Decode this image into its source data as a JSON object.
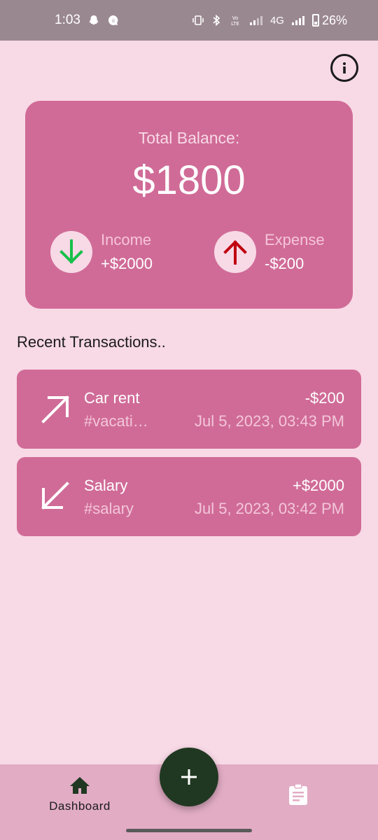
{
  "status_bar": {
    "time": "1:03",
    "battery": "26%",
    "network": "4G",
    "icons": [
      "snapchat-icon",
      "chat-icon",
      "vibrate-icon",
      "bluetooth-icon",
      "volte-icon",
      "signal-icon",
      "battery-icon"
    ]
  },
  "balance": {
    "label": "Total Balance:",
    "amount": "$1800",
    "income_label": "Income",
    "income_value": "+$2000",
    "expense_label": "Expense",
    "expense_value": "-$200"
  },
  "recent": {
    "title": "Recent Transactions..",
    "transactions": [
      {
        "title": "Car rent",
        "tag": "#vacati…",
        "amount": "-$200",
        "date": "Jul 5, 2023, 03:43 PM",
        "direction": "expense"
      },
      {
        "title": "Salary",
        "tag": "#salary",
        "amount": "+$2000",
        "date": "Jul 5, 2023, 03:42 PM",
        "direction": "income"
      }
    ]
  },
  "nav": {
    "dashboard_label": "Dashboard"
  },
  "colors": {
    "background": "#f8d9e6",
    "card": "#d06b97",
    "income_arrow": "#17c04a",
    "expense_arrow": "#c00010",
    "fab": "#203821",
    "nav_bar": "#e2acc5"
  }
}
